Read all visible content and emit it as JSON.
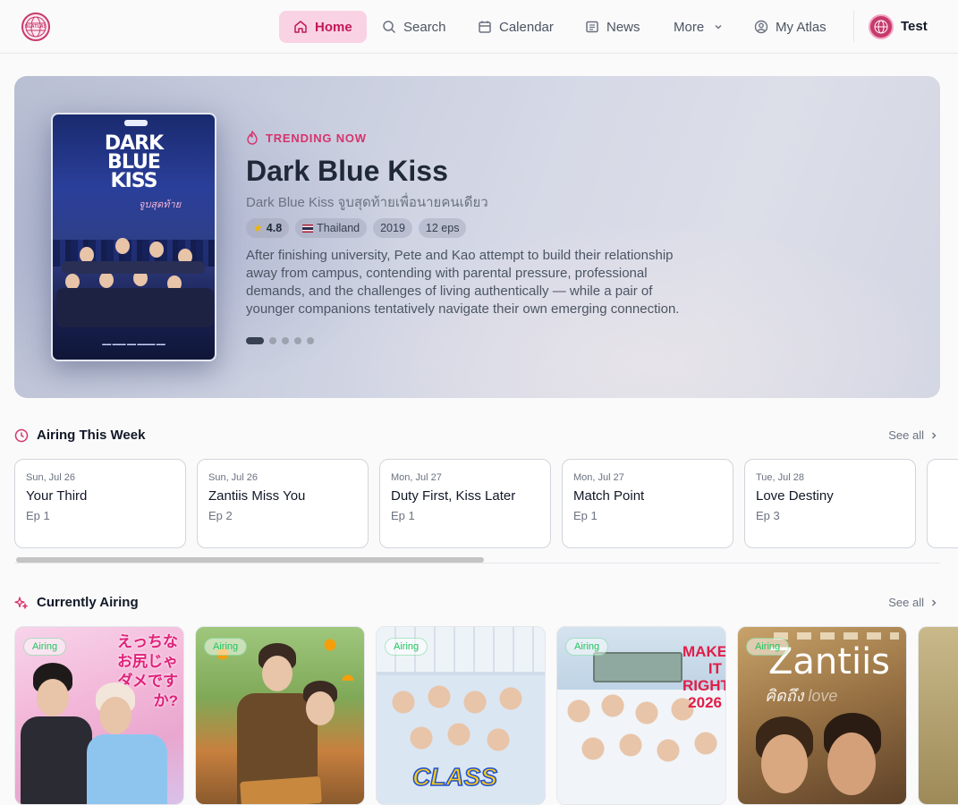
{
  "brand": {
    "logo_text": "BLATLAS",
    "accent": "#c2185b"
  },
  "nav": {
    "items": [
      {
        "label": "Home",
        "icon": "home-icon",
        "active": true
      },
      {
        "label": "Search",
        "icon": "search-icon"
      },
      {
        "label": "Calendar",
        "icon": "calendar-icon"
      },
      {
        "label": "News",
        "icon": "newspaper-icon"
      },
      {
        "label": "More",
        "icon": "chevron-down-icon"
      },
      {
        "label": "My Atlas",
        "icon": "user-circle-icon"
      }
    ],
    "user": "Test"
  },
  "hero": {
    "tag": "TRENDING NOW",
    "title": "Dark Blue Kiss",
    "subtitle": "Dark Blue Kiss จูบสุดท้ายเพื่อนายคนเดียว",
    "rating": "4.8",
    "country": "Thailand",
    "year": "2019",
    "episodes": "12 eps",
    "description": "After finishing university, Pete and Kao attempt to build their relationship away from campus, contending with parental pressure, professional demands, and the challenges of living authentically — while a pair of younger companions tentatively navigate their own emerging connection.",
    "poster_title": "DARK BLUE KISS",
    "poster_subtitle": "จูบสุดท้าย",
    "slides": 5,
    "active_slide": 1
  },
  "airing_week": {
    "title": "Airing This Week",
    "see_all": "See all",
    "cards": [
      {
        "date": "Sun, Jul 26",
        "title": "Your Third",
        "ep": "Ep 1"
      },
      {
        "date": "Sun, Jul 26",
        "title": "Zantiis Miss You",
        "ep": "Ep 2"
      },
      {
        "date": "Mon, Jul 27",
        "title": "Duty First, Kiss Later",
        "ep": "Ep 1"
      },
      {
        "date": "Mon, Jul 27",
        "title": "Match Point",
        "ep": "Ep 1"
      },
      {
        "date": "Tue, Jul 28",
        "title": "Love Destiny",
        "ep": "Ep 3"
      }
    ]
  },
  "currently_airing": {
    "title": "Currently Airing",
    "see_all": "See all",
    "badge": "Airing",
    "posters": [
      {
        "text": "えっちな お尻じゃ ダメですか?"
      },
      {
        "text": ""
      },
      {
        "text": "CLASS"
      },
      {
        "text": "MAKE IT RIGHT 2026"
      },
      {
        "text": "Zantiis"
      }
    ]
  }
}
